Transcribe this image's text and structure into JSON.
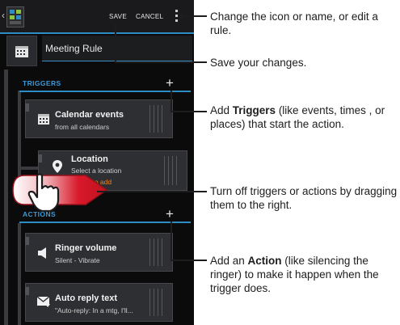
{
  "actionbar": {
    "save_label": "SAVE",
    "cancel_label": "CANCEL"
  },
  "rule": {
    "name": "Meeting Rule"
  },
  "triggers": {
    "section_label": "TRIGGERS",
    "items": [
      {
        "title": "Calendar events",
        "subtitle": "from all calendars"
      },
      {
        "title": "Location",
        "subtitle": "Select a location",
        "hint": "h here to add"
      }
    ]
  },
  "actions": {
    "section_label": "ACTIONS",
    "items": [
      {
        "title": "Ringer volume",
        "subtitle": "Silent - Vibrate"
      },
      {
        "title": "Auto reply text",
        "subtitle": "\"Auto-reply: In a mtg, I'll..."
      }
    ]
  },
  "callouts": {
    "menu": "Change the icon or name, or edit a rule.",
    "save": "Save your changes.",
    "triggers_bold": "Triggers",
    "triggers_pre": "Add ",
    "triggers_post": " (like events, times , or places) that start the action.",
    "drag": "Turn off triggers or actions by dragging them to the right.",
    "action_pre": "Add an ",
    "action_bold": "Action",
    "action_post": " (like silencing the ringer) to make it happen when the trigger does."
  },
  "colors": {
    "accent_blue": "#2f8dc6",
    "hint_orange": "#f0841c",
    "overlay_red": "#d7192b"
  }
}
